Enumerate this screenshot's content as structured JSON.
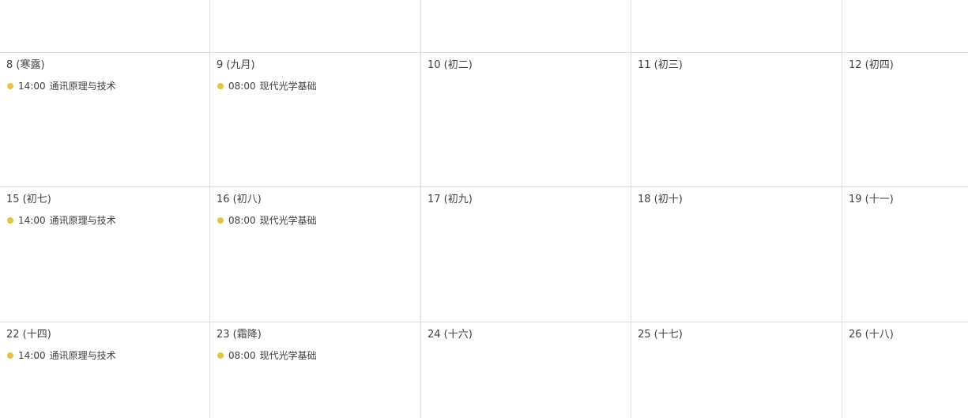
{
  "colors": {
    "grid_line": "#dadce0",
    "event_dot": "#e4c441",
    "text": "#3c4043"
  },
  "weeks": [
    {
      "days": [
        {
          "label": "",
          "events": []
        },
        {
          "label": "",
          "events": []
        },
        {
          "label": "",
          "events": []
        },
        {
          "label": "",
          "events": []
        },
        {
          "label": "",
          "events": []
        }
      ]
    },
    {
      "days": [
        {
          "label": "8 (寒露)",
          "events": [
            {
              "time": "14:00",
              "title": "通讯原理与技术"
            }
          ]
        },
        {
          "label": "9 (九月)",
          "events": [
            {
              "time": "08:00",
              "title": "现代光学基础"
            }
          ]
        },
        {
          "label": "10 (初二)",
          "events": []
        },
        {
          "label": "11 (初三)",
          "events": []
        },
        {
          "label": "12 (初四)",
          "events": []
        }
      ]
    },
    {
      "days": [
        {
          "label": "15 (初七)",
          "events": [
            {
              "time": "14:00",
              "title": "通讯原理与技术"
            }
          ]
        },
        {
          "label": "16 (初八)",
          "events": [
            {
              "time": "08:00",
              "title": "现代光学基础"
            }
          ]
        },
        {
          "label": "17 (初九)",
          "events": []
        },
        {
          "label": "18 (初十)",
          "events": []
        },
        {
          "label": "19 (十一)",
          "events": []
        }
      ]
    },
    {
      "days": [
        {
          "label": "22 (十四)",
          "events": [
            {
              "time": "14:00",
              "title": "通讯原理与技术"
            }
          ]
        },
        {
          "label": "23 (霜降)",
          "events": [
            {
              "time": "08:00",
              "title": "现代光学基础"
            }
          ]
        },
        {
          "label": "24 (十六)",
          "events": []
        },
        {
          "label": "25 (十七)",
          "events": []
        },
        {
          "label": "26 (十八)",
          "events": []
        }
      ]
    }
  ]
}
